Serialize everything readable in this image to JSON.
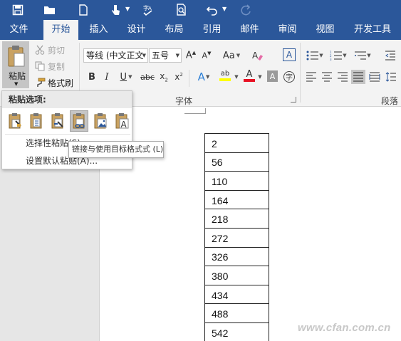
{
  "tabs": [
    "文件",
    "开始",
    "插入",
    "设计",
    "布局",
    "引用",
    "邮件",
    "审阅",
    "视图",
    "开发工具"
  ],
  "active_tab": "开始",
  "clipboard": {
    "paste_label": "粘贴",
    "cut_label": "剪切",
    "copy_label": "复制",
    "format_painter_label": "格式刷"
  },
  "font_group": {
    "font_name": "等线 (中文正文",
    "font_size": "五号",
    "label": "字体"
  },
  "paragraph_group": {
    "label": "段落"
  },
  "paste_menu": {
    "header": "粘贴选项:",
    "options": [
      "keep-source-formatting",
      "merge-formatting",
      "nest-table",
      "link-destination-styles",
      "picture",
      "keep-text-only"
    ],
    "selective_paste_label": "选择性粘贴(S)...",
    "set_default_label": "设置默认粘贴(A)..."
  },
  "tooltip": "链接与使用目标格式式 (L)",
  "table_values": [
    "2",
    "56",
    "110",
    "164",
    "218",
    "272",
    "326",
    "380",
    "434",
    "488",
    "542"
  ],
  "watermark": "www.cfan.com.cn",
  "colors": {
    "brand_blue": "#2b579a",
    "ribbon_bg": "#f3f3f3",
    "highlight_gray": "#c5c5c5",
    "highlight_yellow": "#ffff00",
    "font_color_red": "#e81123"
  }
}
